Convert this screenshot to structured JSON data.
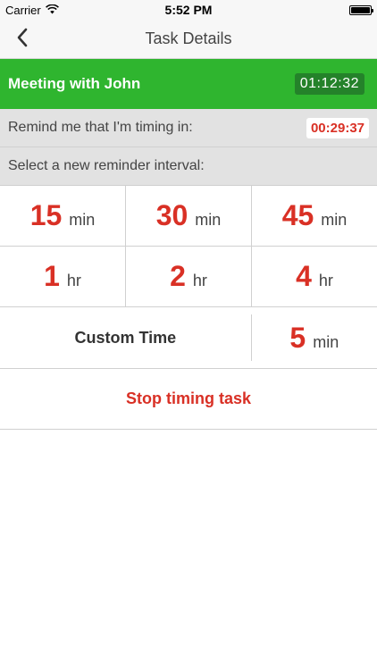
{
  "status_bar": {
    "carrier": "Carrier",
    "time": "5:52 PM",
    "icons": [
      "wifi-icon",
      "battery-icon"
    ]
  },
  "nav": {
    "back_icon": "chevron-left-icon",
    "title": "Task Details"
  },
  "task": {
    "title": "Meeting with John",
    "elapsed": "01:12:32"
  },
  "reminder": {
    "label": "Remind me that I'm timing in:",
    "countdown": "00:29:37"
  },
  "interval": {
    "label": "Select a new reminder interval:",
    "rows": [
      [
        {
          "value": "15",
          "unit": "min"
        },
        {
          "value": "30",
          "unit": "min"
        },
        {
          "value": "45",
          "unit": "min"
        }
      ],
      [
        {
          "value": "1",
          "unit": "hr"
        },
        {
          "value": "2",
          "unit": "hr"
        },
        {
          "value": "4",
          "unit": "hr"
        }
      ]
    ],
    "custom_label": "Custom Time",
    "custom_value": {
      "value": "5",
      "unit": "min"
    }
  },
  "actions": {
    "stop_label": "Stop timing task"
  },
  "colors": {
    "green": "#2fb52f",
    "dark_green": "#24822a",
    "red": "#d93025",
    "gray_band": "#e2e2e2"
  }
}
